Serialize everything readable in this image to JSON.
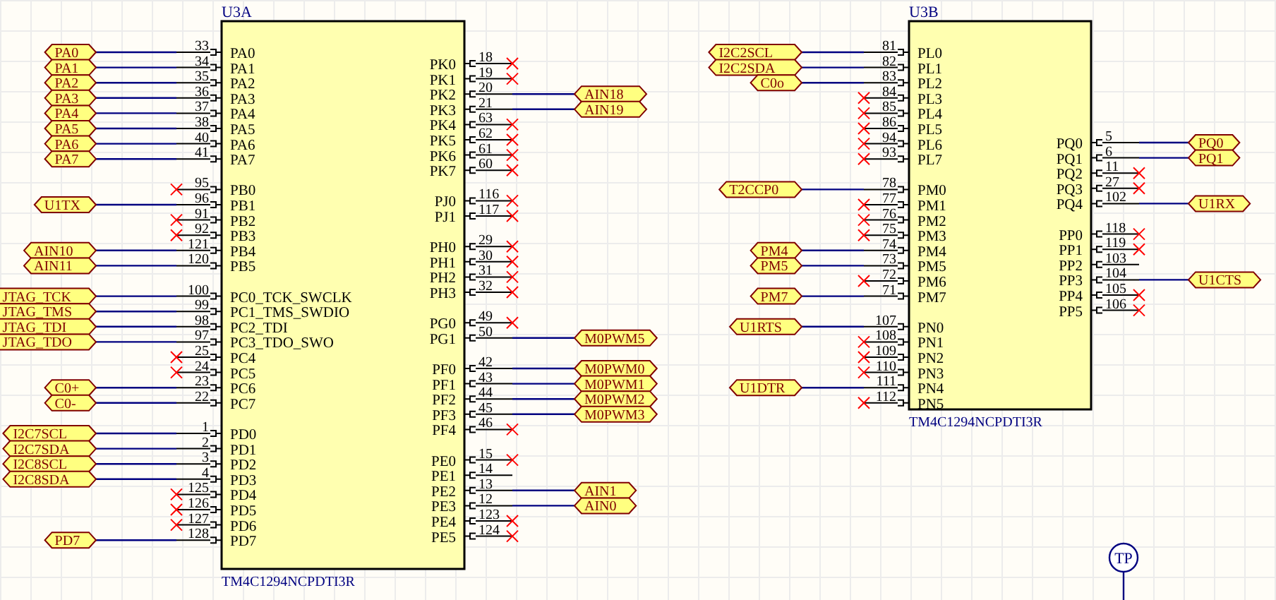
{
  "parts": [
    {
      "designator": "U3A",
      "part_name": "TM4C1294NCPDTI3R",
      "left_groups": [
        [
          {
            "number": "33",
            "name": "PA0",
            "net": "PA0",
            "no_connect": false
          },
          {
            "number": "34",
            "name": "PA1",
            "net": "PA1",
            "no_connect": false
          },
          {
            "number": "35",
            "name": "PA2",
            "net": "PA2",
            "no_connect": false
          },
          {
            "number": "36",
            "name": "PA3",
            "net": "PA3",
            "no_connect": false
          },
          {
            "number": "37",
            "name": "PA4",
            "net": "PA4",
            "no_connect": false
          },
          {
            "number": "38",
            "name": "PA5",
            "net": "PA5",
            "no_connect": false
          },
          {
            "number": "40",
            "name": "PA6",
            "net": "PA6",
            "no_connect": false
          },
          {
            "number": "41",
            "name": "PA7",
            "net": "PA7",
            "no_connect": false
          }
        ],
        [
          {
            "number": "95",
            "name": "PB0",
            "no_connect": true
          },
          {
            "number": "96",
            "name": "PB1",
            "net": "U1TX",
            "no_connect": false
          },
          {
            "number": "91",
            "name": "PB2",
            "no_connect": true
          },
          {
            "number": "92",
            "name": "PB3",
            "no_connect": true
          },
          {
            "number": "121",
            "name": "PB4",
            "net": "AIN10",
            "no_connect": false
          },
          {
            "number": "120",
            "name": "PB5",
            "net": "AIN11",
            "no_connect": false
          }
        ],
        [
          {
            "number": "100",
            "name": "PC0_TCK_SWCLK",
            "net": "JTAG_TCK",
            "no_connect": false
          },
          {
            "number": "99",
            "name": "PC1_TMS_SWDIO",
            "net": "JTAG_TMS",
            "no_connect": false
          },
          {
            "number": "98",
            "name": "PC2_TDI",
            "net": "JTAG_TDI",
            "no_connect": false
          },
          {
            "number": "97",
            "name": "PC3_TDO_SWO",
            "net": "JTAG_TDO",
            "no_connect": false
          },
          {
            "number": "25",
            "name": "PC4",
            "no_connect": true
          },
          {
            "number": "24",
            "name": "PC5",
            "no_connect": true
          },
          {
            "number": "23",
            "name": "PC6",
            "net": "C0+",
            "no_connect": false
          },
          {
            "number": "22",
            "name": "PC7",
            "net": "C0-",
            "no_connect": false
          }
        ],
        [
          {
            "number": "1",
            "name": "PD0",
            "net": "I2C7SCL",
            "no_connect": false
          },
          {
            "number": "2",
            "name": "PD1",
            "net": "I2C7SDA",
            "no_connect": false
          },
          {
            "number": "3",
            "name": "PD2",
            "net": "I2C8SCL",
            "no_connect": false
          },
          {
            "number": "4",
            "name": "PD3",
            "net": "I2C8SDA",
            "no_connect": false
          },
          {
            "number": "125",
            "name": "PD4",
            "no_connect": true
          },
          {
            "number": "126",
            "name": "PD5",
            "no_connect": true
          },
          {
            "number": "127",
            "name": "PD6",
            "no_connect": true
          },
          {
            "number": "128",
            "name": "PD7",
            "net": "PD7",
            "no_connect": false
          }
        ]
      ],
      "right_groups": [
        [
          {
            "number": "18",
            "name": "PK0",
            "no_connect": true
          },
          {
            "number": "19",
            "name": "PK1",
            "no_connect": true
          },
          {
            "number": "20",
            "name": "PK2",
            "net": "AIN18",
            "no_connect": false
          },
          {
            "number": "21",
            "name": "PK3",
            "net": "AIN19",
            "no_connect": false
          },
          {
            "number": "63",
            "name": "PK4",
            "no_connect": true
          },
          {
            "number": "62",
            "name": "PK5",
            "no_connect": true
          },
          {
            "number": "61",
            "name": "PK6",
            "no_connect": true
          },
          {
            "number": "60",
            "name": "PK7",
            "no_connect": true
          }
        ],
        [
          {
            "number": "116",
            "name": "PJ0",
            "no_connect": true
          },
          {
            "number": "117",
            "name": "PJ1",
            "no_connect": true
          }
        ],
        [
          {
            "number": "29",
            "name": "PH0",
            "no_connect": true
          },
          {
            "number": "30",
            "name": "PH1",
            "no_connect": true
          },
          {
            "number": "31",
            "name": "PH2",
            "no_connect": true
          },
          {
            "number": "32",
            "name": "PH3",
            "no_connect": true
          }
        ],
        [
          {
            "number": "49",
            "name": "PG0",
            "no_connect": true
          },
          {
            "number": "50",
            "name": "PG1",
            "net": "M0PWM5",
            "no_connect": false
          }
        ],
        [
          {
            "number": "42",
            "name": "PF0",
            "net": "M0PWM0",
            "no_connect": false
          },
          {
            "number": "43",
            "name": "PF1",
            "net": "M0PWM1",
            "no_connect": false
          },
          {
            "number": "44",
            "name": "PF2",
            "net": "M0PWM2",
            "no_connect": false
          },
          {
            "number": "45",
            "name": "PF3",
            "net": "M0PWM3",
            "no_connect": false
          },
          {
            "number": "46",
            "name": "PF4",
            "no_connect": true
          }
        ],
        [
          {
            "number": "15",
            "name": "PE0",
            "no_connect": true
          },
          {
            "number": "14",
            "name": "PE1",
            "no_connect": false
          },
          {
            "number": "13",
            "name": "PE2",
            "net": "AIN1",
            "no_connect": false
          },
          {
            "number": "12",
            "name": "PE3",
            "net": "AIN0",
            "no_connect": false
          },
          {
            "number": "123",
            "name": "PE4",
            "no_connect": true
          },
          {
            "number": "124",
            "name": "PE5",
            "no_connect": true
          }
        ]
      ]
    },
    {
      "designator": "U3B",
      "part_name": "TM4C1294NCPDTI3R",
      "left_groups": [
        [
          {
            "number": "81",
            "name": "PL0",
            "net": "I2C2SCL",
            "no_connect": false
          },
          {
            "number": "82",
            "name": "PL1",
            "net": "I2C2SDA",
            "no_connect": false
          },
          {
            "number": "83",
            "name": "PL2",
            "net": "C0o",
            "no_connect": false
          },
          {
            "number": "84",
            "name": "PL3",
            "no_connect": true
          },
          {
            "number": "85",
            "name": "PL4",
            "no_connect": true
          },
          {
            "number": "86",
            "name": "PL5",
            "no_connect": true
          },
          {
            "number": "94",
            "name": "PL6",
            "no_connect": true
          },
          {
            "number": "93",
            "name": "PL7",
            "no_connect": true
          }
        ],
        [
          {
            "number": "78",
            "name": "PM0",
            "net": "T2CCP0",
            "no_connect": false
          },
          {
            "number": "77",
            "name": "PM1",
            "no_connect": true
          },
          {
            "number": "76",
            "name": "PM2",
            "no_connect": true
          },
          {
            "number": "75",
            "name": "PM3",
            "no_connect": true
          },
          {
            "number": "74",
            "name": "PM4",
            "net": "PM4",
            "no_connect": false
          },
          {
            "number": "73",
            "name": "PM5",
            "net": "PM5",
            "no_connect": false
          },
          {
            "number": "72",
            "name": "PM6",
            "no_connect": true
          },
          {
            "number": "71",
            "name": "PM7",
            "net": "PM7",
            "no_connect": false
          }
        ],
        [
          {
            "number": "107",
            "name": "PN0",
            "net": "U1RTS",
            "no_connect": false
          },
          {
            "number": "108",
            "name": "PN1",
            "no_connect": true
          },
          {
            "number": "109",
            "name": "PN2",
            "no_connect": true
          },
          {
            "number": "110",
            "name": "PN3",
            "no_connect": true
          },
          {
            "number": "111",
            "name": "PN4",
            "net": "U1DTR",
            "no_connect": false
          },
          {
            "number": "112",
            "name": "PN5",
            "no_connect": true
          }
        ]
      ],
      "right_groups": [
        [
          {
            "number": "5",
            "name": "PQ0",
            "net": "PQ0",
            "no_connect": false
          },
          {
            "number": "6",
            "name": "PQ1",
            "net": "PQ1",
            "no_connect": false
          },
          {
            "number": "11",
            "name": "PQ2",
            "no_connect": true
          },
          {
            "number": "27",
            "name": "PQ3",
            "no_connect": true
          },
          {
            "number": "102",
            "name": "PQ4",
            "net": "U1RX",
            "no_connect": false
          }
        ],
        [
          {
            "number": "118",
            "name": "PP0",
            "no_connect": true
          },
          {
            "number": "119",
            "name": "PP1",
            "no_connect": true
          },
          {
            "number": "103",
            "name": "PP2",
            "no_connect": false
          },
          {
            "number": "104",
            "name": "PP3",
            "net": "U1CTS",
            "no_connect": false
          },
          {
            "number": "105",
            "name": "PP4",
            "no_connect": true
          },
          {
            "number": "106",
            "name": "PP5",
            "no_connect": true
          }
        ]
      ]
    }
  ],
  "test_point": {
    "label": "TP"
  }
}
